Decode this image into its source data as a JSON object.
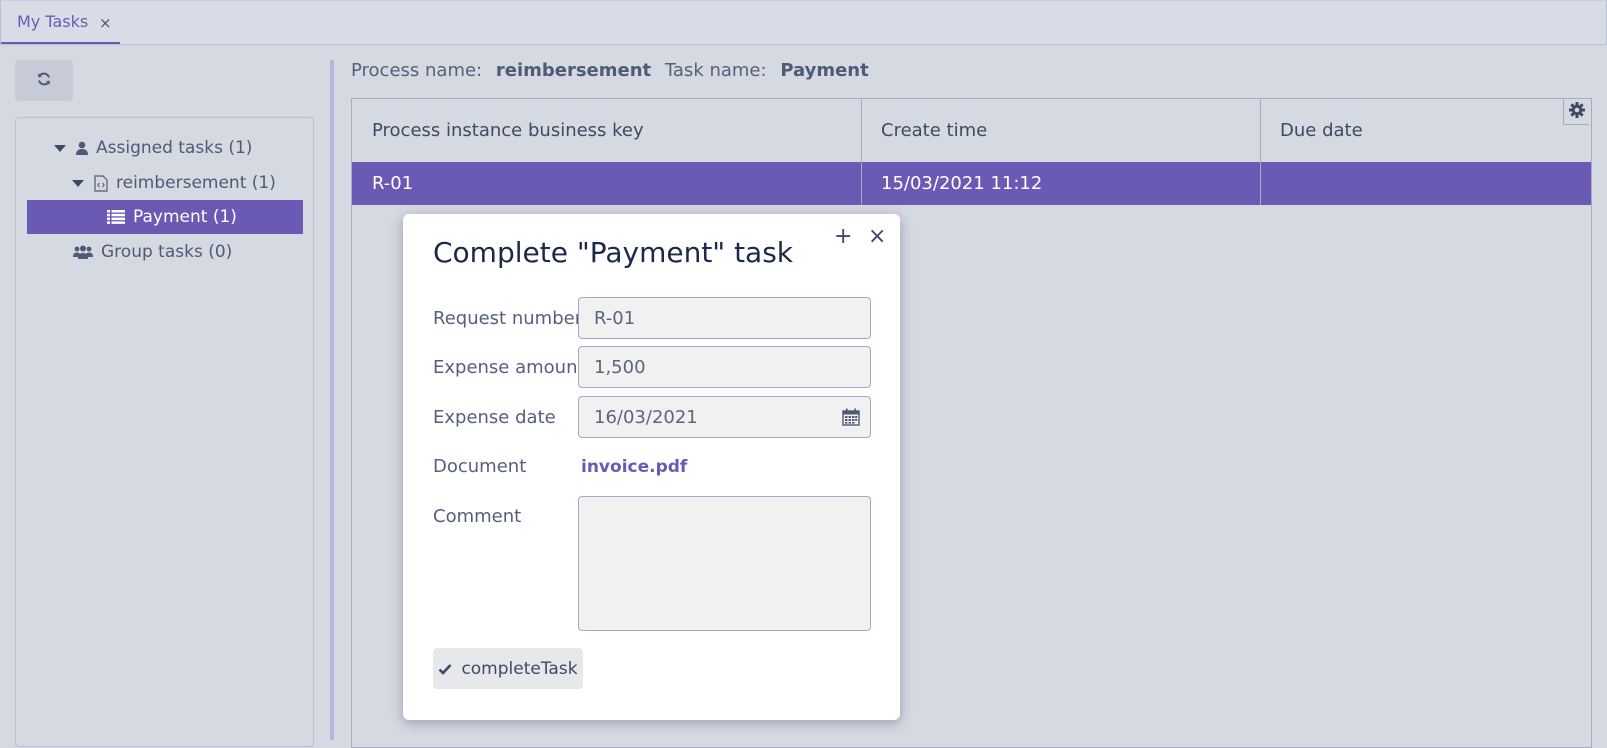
{
  "tabs": [
    {
      "label": "My Tasks",
      "close": "×"
    }
  ],
  "tree": {
    "assigned": "Assigned tasks (1)",
    "process": "reimbersement (1)",
    "task": "Payment (1)",
    "group": "Group tasks (0)"
  },
  "process_info": {
    "process_label": "Process name:",
    "process_value": "reimbersement",
    "task_label": "Task name:",
    "task_value": "Payment"
  },
  "table": {
    "columns": [
      "Process instance business key",
      "Create time",
      "Due date"
    ],
    "rows": [
      {
        "key": "R-01",
        "create_time": "15/03/2021 11:12",
        "due_date": ""
      }
    ]
  },
  "dialog": {
    "title": "Complete \"Payment\" task",
    "fields": {
      "request_number": {
        "label": "Request number",
        "value": "R-01"
      },
      "expense_amount": {
        "label": "Expense amount",
        "value": "1,500"
      },
      "expense_date": {
        "label": "Expense date",
        "value": "16/03/2021"
      },
      "document": {
        "label": "Document",
        "value": "invoice.pdf"
      },
      "comment": {
        "label": "Comment",
        "value": ""
      }
    },
    "complete_button": "completeTask"
  },
  "colors": {
    "accent": "#6a5ab4",
    "background": "#d5d9e2",
    "dialog": "#ffffff"
  }
}
